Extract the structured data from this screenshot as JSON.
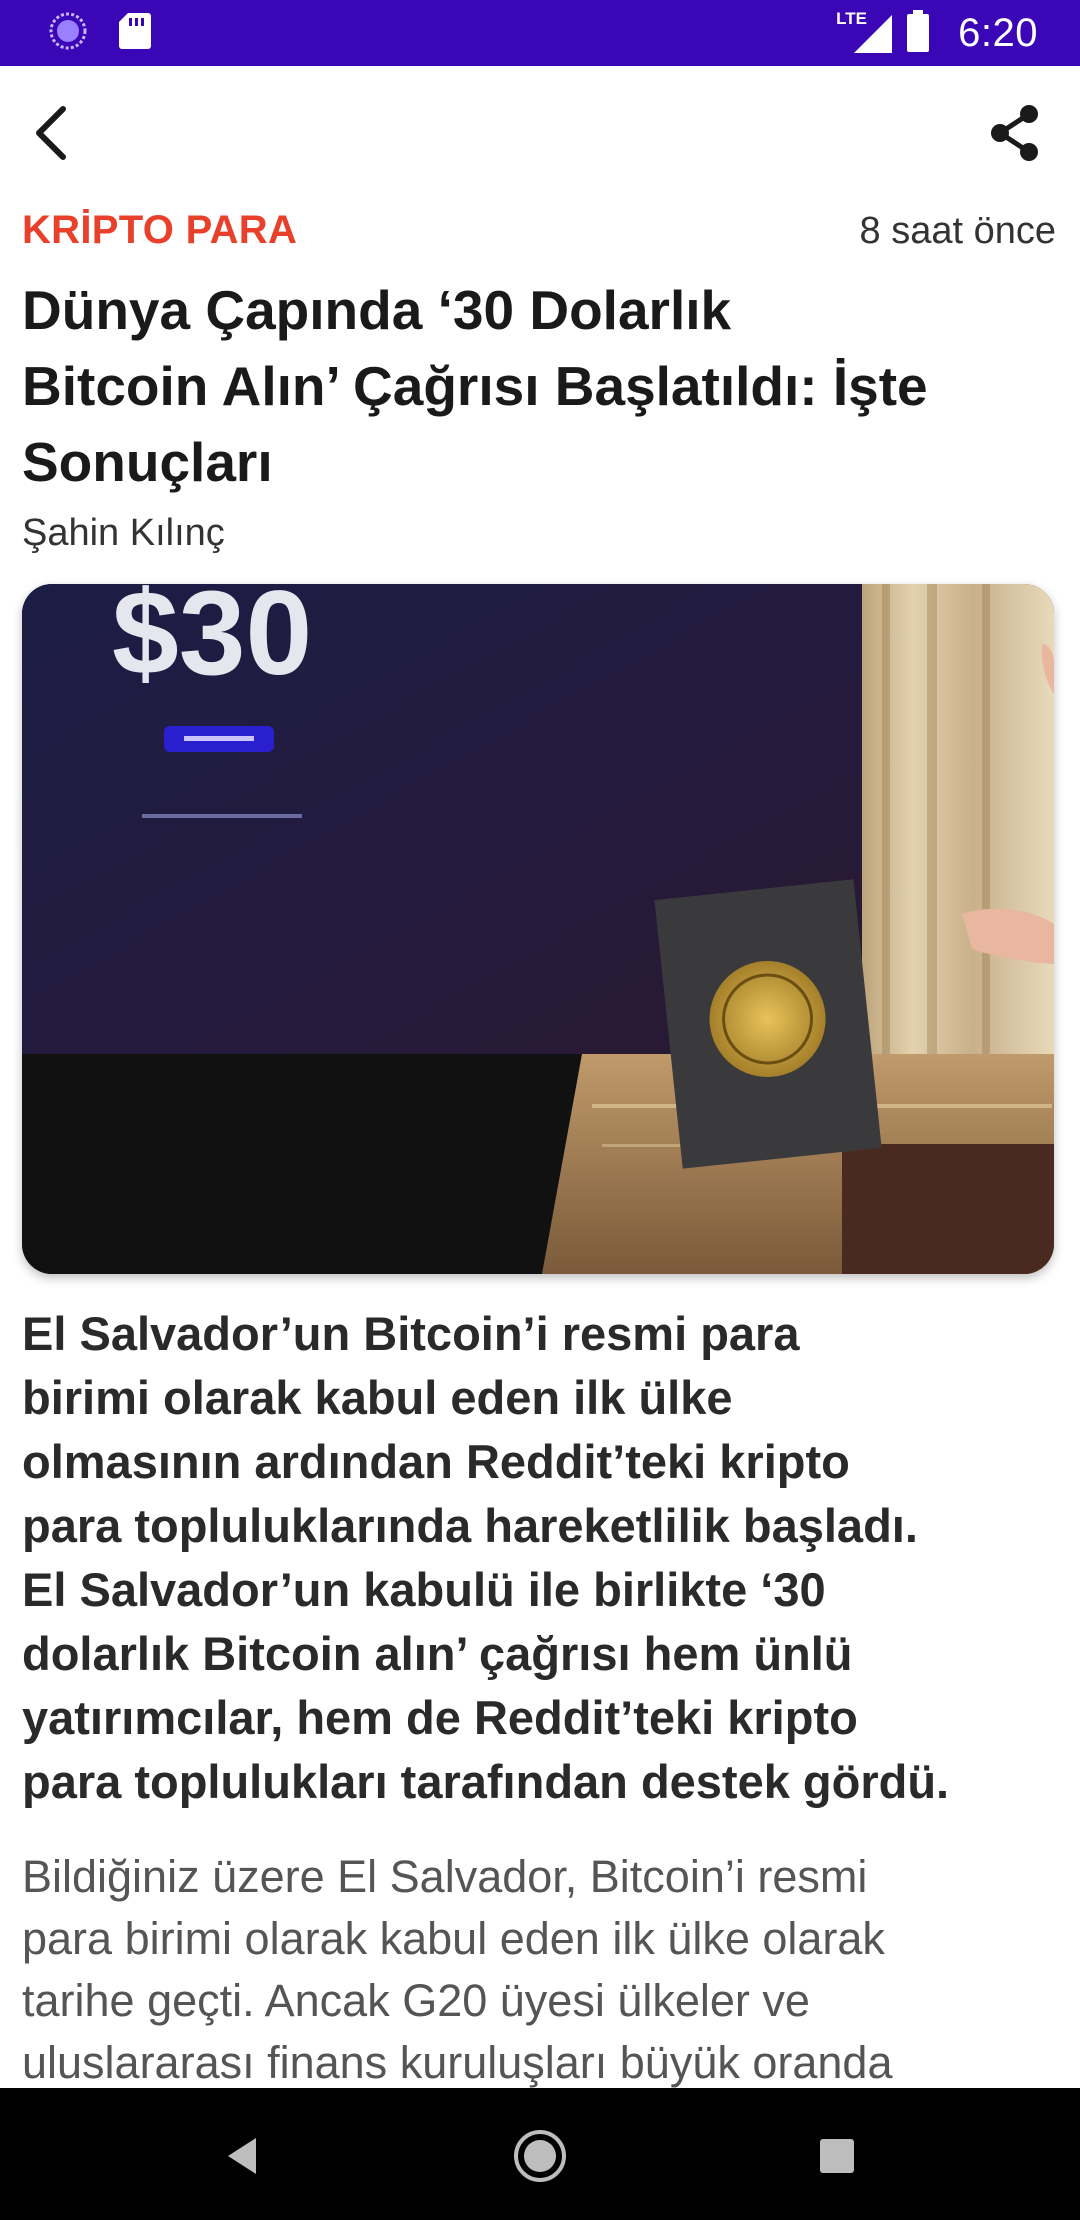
{
  "status_bar": {
    "time": "6:20",
    "network": "LTE",
    "icons": [
      "assistant-icon",
      "sd-card-icon",
      "lte-signal-icon",
      "battery-icon"
    ]
  },
  "app_bar": {
    "back_icon": "back-arrow-icon",
    "share_icon": "share-icon"
  },
  "article": {
    "category": "KRİPTO PARA",
    "time_ago": "8 saat önce",
    "headline_lines": [
      "Dünya Çapında ‘30 Dolarlık",
      "Bitcoin Alın’ Çağrısı Başlatıldı: İşte",
      "Sonuçları"
    ],
    "author": "Şahin Kılınç",
    "hero_image": {
      "overlay_text": "$30"
    },
    "lead_lines": [
      "El Salvador’un Bitcoin’i resmi para",
      "birimi olarak kabul eden ilk ülke",
      "olmasının ardından Reddit’teki kripto",
      "para topluluklarında hareketlilik başladı.",
      "El Salvador’un kabulü ile birlikte ‘30",
      "dolarlık Bitcoin alın’ çağrısı hem ünlü",
      "yatırımcılar, hem de Reddit’teki kripto",
      "para toplulukları tarafından destek gördü."
    ],
    "body_lines": [
      "Bildiğiniz üzere El Salvador, Bitcoin’i resmi",
      "para birimi olarak kabul eden ilk ülke olarak",
      "tarihe geçti. Ancak G20 üyesi ülkeler ve",
      "uluslararası finans kuruluşları büyük oranda"
    ]
  },
  "nav_bar": {
    "back": "nav-back-icon",
    "home": "nav-home-icon",
    "recents": "nav-recents-icon"
  },
  "colors": {
    "status_bar": "#3b06b5",
    "category": "#e8402a",
    "headline": "#1a1a1a",
    "body": "#555555",
    "nav_bar": "#000000"
  }
}
